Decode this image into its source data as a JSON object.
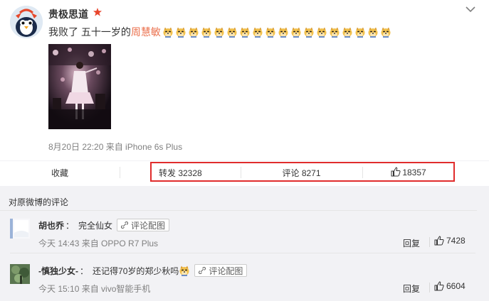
{
  "post": {
    "username": "贵极思道",
    "text_prefix": "我败了 五十一岁的",
    "text_link": "周慧敏",
    "emoji_name": "doge-emoji",
    "emoji_count": 18,
    "meta": "8月20日 22:20 来自 iPhone 6s Plus"
  },
  "actions": {
    "collect": "收藏",
    "repost": "转发 32328",
    "comment": "评论 8271",
    "like": "18357"
  },
  "comments_section": {
    "title": "对原微博的评论",
    "items": [
      {
        "user": "胡也乔",
        "sep": "：",
        "text": "完全仙女",
        "pic_button": "评论配图",
        "meta": "今天 14:43 来自 OPPO R7 Plus",
        "reply": "回复",
        "likes": "7428"
      },
      {
        "user": "-慎独少女-",
        "sep": "：",
        "text": "还记得70岁的郑少秋吗",
        "pic_button": "评论配图",
        "meta": "今天 15:10 来自 vivo智能手机",
        "reply": "回复",
        "likes": "6604"
      }
    ]
  },
  "colors": {
    "link": "#eb7350",
    "highlight_border": "#e02c2c",
    "comments_bg": "#f2f2f5"
  }
}
